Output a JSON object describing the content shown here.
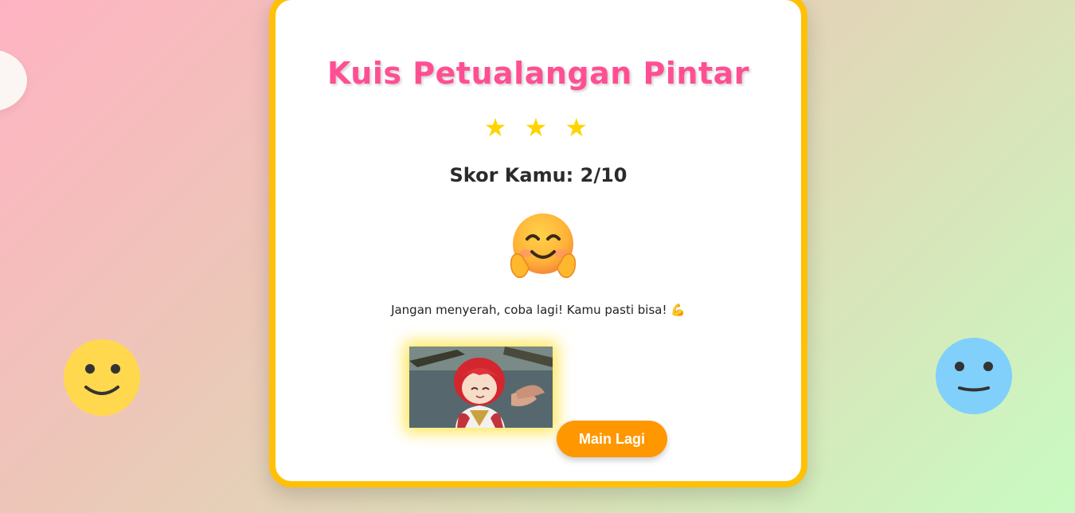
{
  "quiz": {
    "title": "Kuis Petualangan Pintar",
    "stars": "★ ★ ★",
    "score_text": "Skor Kamu: 2/10",
    "score": 2,
    "score_max": 10,
    "result_emoji": "hugging-face",
    "message": "Jangan menyerah, coba lagi! Kamu pasti bisa!",
    "message_emoji": "💪",
    "play_again_label": "Main Lagi"
  },
  "decorations": {
    "left_smiley_color": "#ffd84d",
    "right_smiley_color": "#80d0fb",
    "card_border_color": "#ffc107",
    "title_color": "#ff4f93",
    "button_color": "#ff9800"
  }
}
